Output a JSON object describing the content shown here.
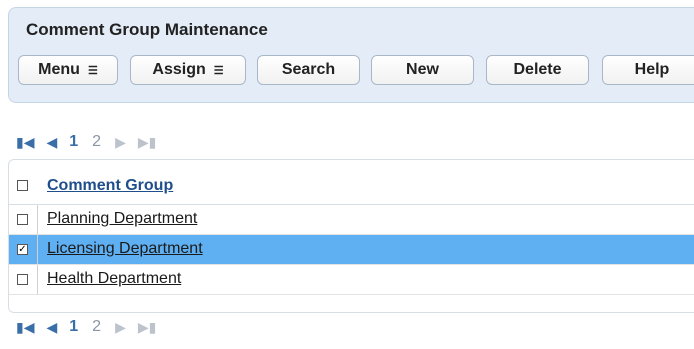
{
  "panel": {
    "title": "Comment Group Maintenance",
    "buttons": {
      "menu": "Menu",
      "assign": "Assign",
      "search": "Search",
      "new": "New",
      "delete": "Delete",
      "help": "Help"
    }
  },
  "pager": {
    "current_page": "1",
    "other_page": "2"
  },
  "table": {
    "header": "Comment Group",
    "rows": [
      {
        "label": "Planning Department",
        "checked": false
      },
      {
        "label": "Licensing Department",
        "checked": true
      },
      {
        "label": "Health Department",
        "checked": false
      }
    ]
  },
  "colors": {
    "selected_row": "#5fb0f2",
    "header_link": "#1f4f8b",
    "panel_bg": "#e4edf7"
  }
}
